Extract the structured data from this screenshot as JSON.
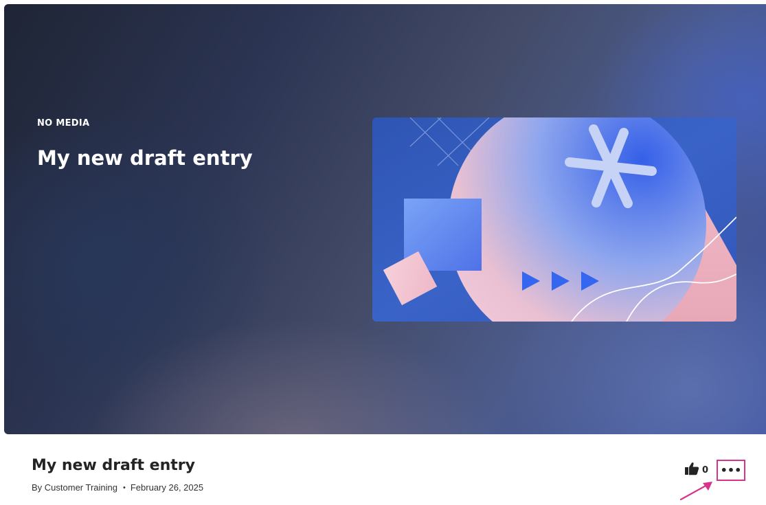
{
  "hero": {
    "badge": "NO MEDIA",
    "title": "My new draft entry"
  },
  "entry": {
    "title": "My new draft entry",
    "author": "By Customer Training",
    "separator": "•",
    "date": "February 26, 2025",
    "likes": "0",
    "more_label": "•••"
  },
  "icons": {
    "like": "thumbs-up-icon",
    "more": "more-options-icon",
    "annotation": "annotation-arrow-icon"
  },
  "colors": {
    "highlight": "#d6338d",
    "text": "#242424"
  }
}
